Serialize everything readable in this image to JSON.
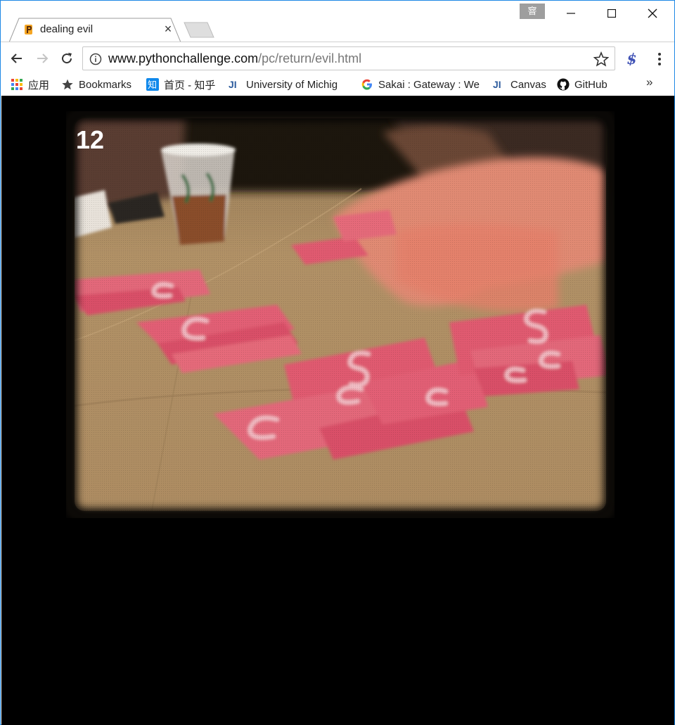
{
  "tab": {
    "title": "dealing evil",
    "close_glyph": "×"
  },
  "ime_badge": "窨",
  "address_bar": {
    "host": "www.pythonchallenge.com",
    "path": "/pc/return/evil.html"
  },
  "bookmarks": {
    "apps": "应用",
    "items": [
      {
        "label": "Bookmarks",
        "icon": "star-icon"
      },
      {
        "label": "首页 - 知乎",
        "icon": "zhihu-icon"
      },
      {
        "label": "University of Michig",
        "icon": "ji-icon"
      },
      {
        "label": "Sakai : Gateway : We",
        "icon": "google-icon"
      },
      {
        "label": "Canvas",
        "icon": "ji-icon"
      },
      {
        "label": "GitHub",
        "icon": "github-icon"
      }
    ],
    "more": "»"
  },
  "page": {
    "image_number": "12",
    "background": "#000000",
    "cloth_color": "#b08a5c",
    "card_color": "#e05a6f"
  }
}
